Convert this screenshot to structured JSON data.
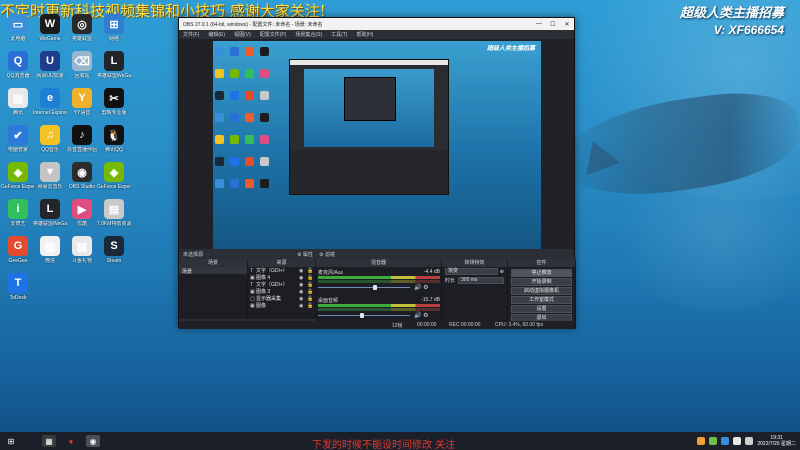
{
  "overlay": {
    "top_text": "不定时更新科技视频集锦和小技巧 感谢大家关注!",
    "brand_line1": "超级人类主播招募",
    "brand_line2": "V: XF666654",
    "subtitle": "下发的时候不能设时间修改 关注"
  },
  "desktop_icons": [
    {
      "label": "此电脑",
      "color": "#3a8fd9",
      "glyph": "▭"
    },
    {
      "label": "WeGame",
      "color": "#1c1c1c",
      "glyph": "W"
    },
    {
      "label": "英雄联盟",
      "color": "#2a2a2a",
      "glyph": "◎"
    },
    {
      "label": "网络",
      "color": "#2f7fd0",
      "glyph": "⊞"
    },
    {
      "label": "QQ浏览器",
      "color": "#2a6fd6",
      "glyph": "Q"
    },
    {
      "label": "网易UU加速",
      "color": "#1f3d8a",
      "glyph": "U"
    },
    {
      "label": "回收站",
      "color": "#9ab6cf",
      "glyph": "⌫"
    },
    {
      "label": "英雄联盟WeGame版",
      "color": "#23252b",
      "glyph": "L"
    },
    {
      "label": "腾讯",
      "color": "#e8e8e8",
      "glyph": "▤"
    },
    {
      "label": "Internet Explorer",
      "color": "#1d7fd4",
      "glyph": "e"
    },
    {
      "label": "YY语音",
      "color": "#f0b12a",
      "glyph": "Y"
    },
    {
      "label": "剪映专业版",
      "color": "#111111",
      "glyph": "✂"
    },
    {
      "label": "电脑管家",
      "color": "#2b7ad9",
      "glyph": "✔"
    },
    {
      "label": "QQ音乐",
      "color": "#f5c223",
      "glyph": "♫"
    },
    {
      "label": "抖音直播伴侣",
      "color": "#111111",
      "glyph": "♪"
    },
    {
      "label": "腾讯QQ",
      "color": "#111111",
      "glyph": "🐧"
    },
    {
      "label": "GeForce Experience",
      "color": "#76b900",
      "glyph": "◈"
    },
    {
      "label": "网易云音乐",
      "color": "#c4c4c4",
      "glyph": "▼"
    },
    {
      "label": "OBS Studio",
      "color": "#2c2c2c",
      "glyph": "◉"
    },
    {
      "label": "GeForce Experience",
      "color": "#76b900",
      "glyph": "◈"
    },
    {
      "label": "爱奇艺",
      "color": "#2fbf5b",
      "glyph": "i"
    },
    {
      "label": "英雄联盟WeGame版",
      "color": "#23252b",
      "glyph": "L"
    },
    {
      "label": "优酷",
      "color": "#e04e80",
      "glyph": "▶"
    },
    {
      "label": "7.8KM特效资源",
      "color": "#c9c9c9",
      "glyph": "▤"
    },
    {
      "label": "GeeGee",
      "color": "#e64a2e",
      "glyph": "G"
    },
    {
      "label": "微信",
      "color": "#f2f2f2",
      "glyph": "▤"
    },
    {
      "label": "斗鱼礼物",
      "color": "#e8e8e8",
      "glyph": "▤"
    },
    {
      "label": "Steam",
      "color": "#1b2838",
      "glyph": "S"
    },
    {
      "label": "ToDesk",
      "color": "#1e73e8",
      "glyph": "T"
    }
  ],
  "obs": {
    "title": "OBS 27.0.1 (64-bit, windows) - 配置文件: 未命名 - 场景: 未命名",
    "menu": [
      "文件(F)",
      "编辑(E)",
      "视图(V)",
      "配置文件(P)",
      "场景集合(S)",
      "工具(T)",
      "帮助(H)"
    ],
    "window_controls": [
      "—",
      "☐",
      "✕"
    ],
    "preview_watermark": "超级人类主播招募",
    "tabs_label": "未选择源",
    "tabs": [
      "属性",
      "滤镜"
    ],
    "panels": {
      "scenes": {
        "title": "场景",
        "items": [
          "场景"
        ]
      },
      "sources": {
        "title": "来源",
        "items": [
          {
            "type": "T",
            "name": "文字（GDI+）"
          },
          {
            "type": "▣",
            "name": "图像 4"
          },
          {
            "type": "T",
            "name": "文字（GDI+）"
          },
          {
            "type": "▣",
            "name": "图像 3"
          },
          {
            "type": "▢",
            "name": "显示器采集"
          },
          {
            "type": "▣",
            "name": "图像"
          }
        ]
      },
      "mixer": {
        "title": "混音器",
        "tracks": [
          {
            "name": "麦克风/Aux",
            "db": "-4.4 dB",
            "knob_pos": 0.62
          },
          {
            "name": "桌面音频",
            "db": "-15.7 dB",
            "knob_pos": 0.48
          }
        ]
      },
      "transitions": {
        "title": "转场特效",
        "type_label": "渐变",
        "duration_label": "时长",
        "duration_value": "300 ms"
      },
      "controls": {
        "title": "控件",
        "buttons": [
          "停止推流",
          "开始录制",
          "启动虚拟摄像机",
          "工作室模式",
          "设置",
          "退出"
        ]
      }
    },
    "status": {
      "dropped": "12帧",
      "live": "00:00:00",
      "rec": "REC 00:00:00",
      "cpu": "CPU: 3.4%, 60.00 fps"
    }
  },
  "taskbar": {
    "clock_time": "19:31",
    "clock_date": "2022/7/26 星期二"
  }
}
